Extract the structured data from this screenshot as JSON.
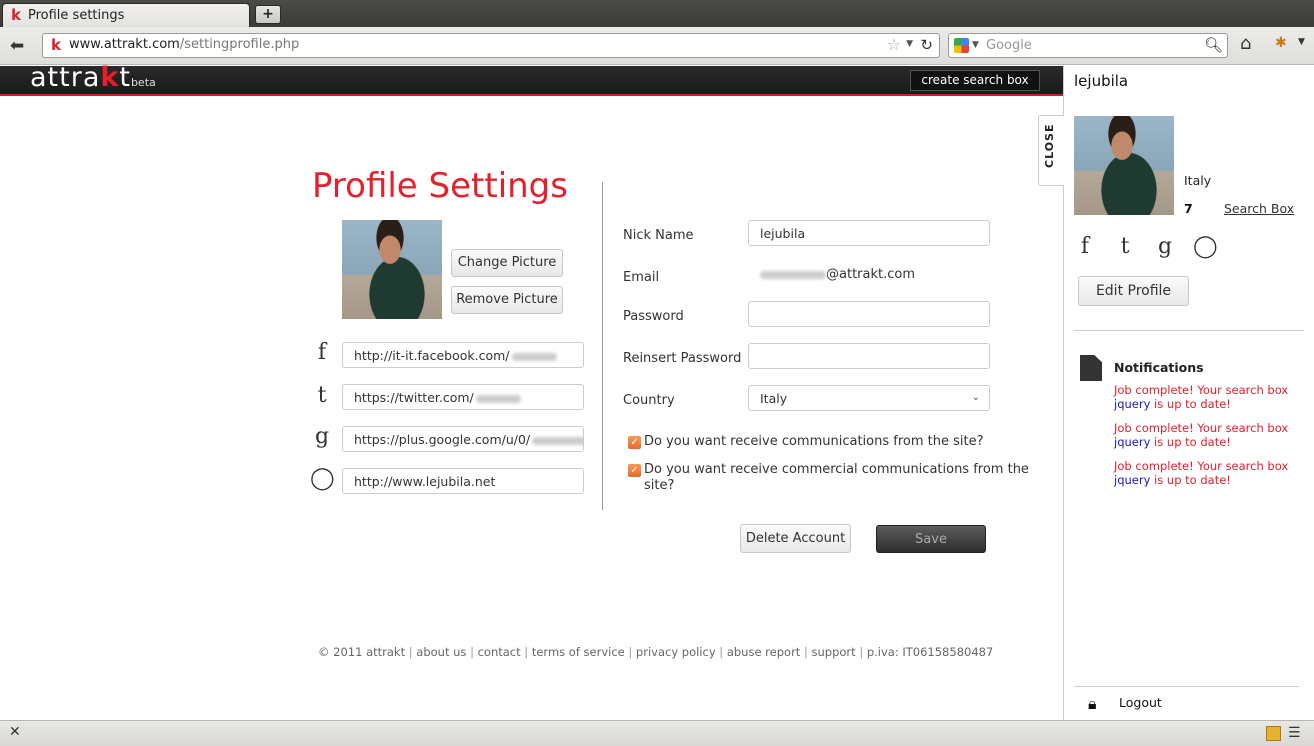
{
  "browser": {
    "tab_title": "Profile settings",
    "tab_favicon": "k",
    "new_tab_icon": "plus-icon",
    "url_domain": "www.attrakt.com",
    "url_path": "/settingprofile.php",
    "search_engine_placeholder": "Google"
  },
  "site": {
    "logo_text": "attra",
    "logo_k": "k",
    "logo_t": "t",
    "logo_beta": "beta",
    "create_search_box": "create search box",
    "accent_color": "#e4202c"
  },
  "main": {
    "title": "Profile Settings",
    "change_picture": "Change Picture",
    "remove_picture": "Remove Picture",
    "social": [
      {
        "icon": "facebook-icon",
        "value": "http://it-it.facebook.com/"
      },
      {
        "icon": "twitter-icon",
        "value": "https://twitter.com/"
      },
      {
        "icon": "google-plus-icon",
        "value": "https://plus.google.com/u/0/"
      },
      {
        "icon": "speech-bubble-icon",
        "value": "http://www.lejubila.net"
      }
    ],
    "form": {
      "nick_label": "Nick Name",
      "nick_value": "lejubila",
      "email_label": "Email",
      "email_value": "@attrakt.com",
      "password_label": "Password",
      "reinsert_label": "Reinsert Password",
      "country_label": "Country",
      "country_value": "Italy",
      "check1": "Do you want receive communications from the site?",
      "check2a": "Do you want receive commercial communications from the",
      "check2b": "site?"
    },
    "delete_account": "Delete Account",
    "save": "Save"
  },
  "footer": {
    "copyright": "© 2011 attrakt",
    "links": [
      "about us",
      "contact",
      "terms of service",
      "privacy policy",
      "abuse report",
      "support"
    ],
    "piva": "p.iva: IT06158580487"
  },
  "sidebar": {
    "close": "CLOSE",
    "username": "lejubila",
    "country": "Italy",
    "count": "7",
    "search_box": "Search Box",
    "edit_profile": "Edit Profile",
    "notifications_title": "Notifications",
    "notifications": [
      {
        "a": "Job complete! Your search box",
        "kw": "jquery",
        "b": " is up to date!"
      },
      {
        "a": "Job complete! Your search box",
        "kw": "jquery",
        "b": " is up to date!"
      },
      {
        "a": "Job complete! Your search box",
        "kw": "jquery",
        "b": " is up to date!"
      }
    ],
    "logout": "Logout"
  }
}
